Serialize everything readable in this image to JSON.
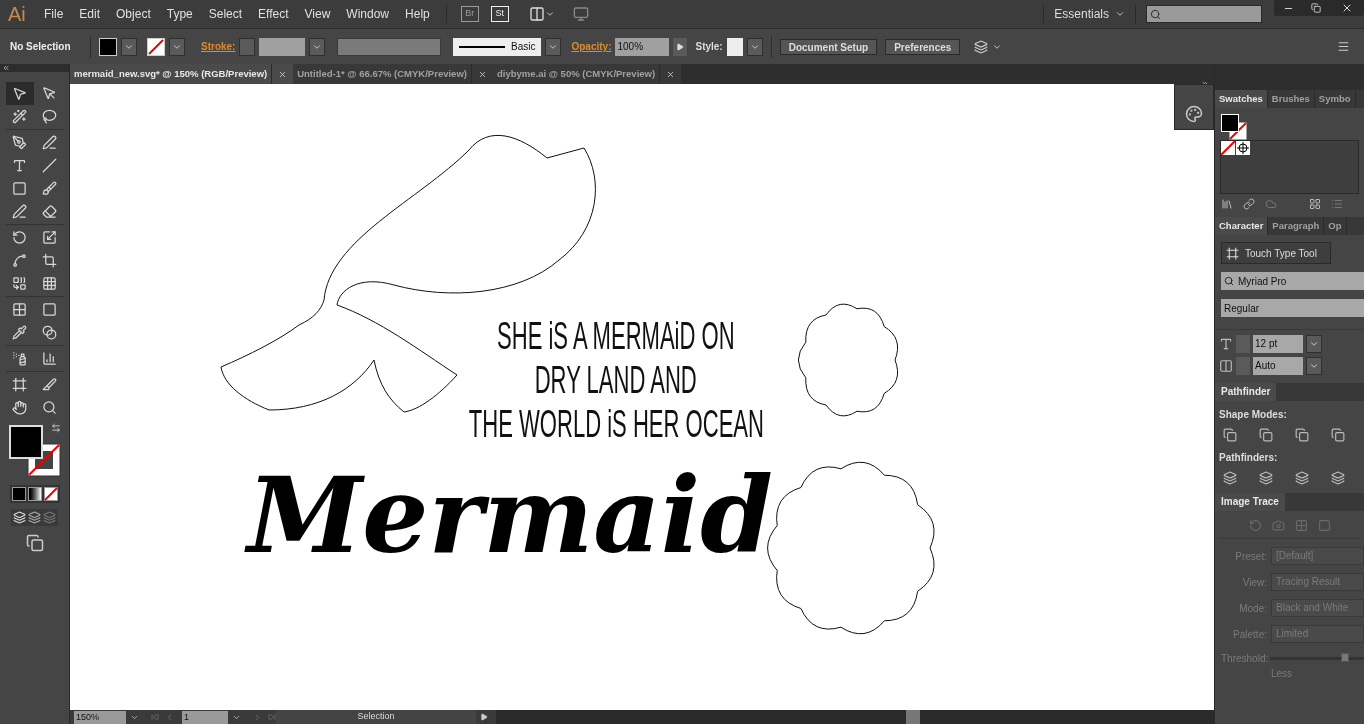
{
  "app_logo": "Ai",
  "menu": [
    "File",
    "Edit",
    "Object",
    "Type",
    "Select",
    "Effect",
    "View",
    "Window",
    "Help"
  ],
  "app_buttons": [
    {
      "label": "Br",
      "disabled": true
    },
    {
      "label": "St",
      "disabled": false
    }
  ],
  "workspace": "Essentials",
  "control_bar": {
    "selection": "No Selection",
    "stroke_label": "Stroke:",
    "brush": "Basic",
    "opacity_label": "Opacity:",
    "opacity": "100%",
    "style_label": "Style:",
    "buttons": [
      "Document Setup",
      "Preferences"
    ]
  },
  "tabs": [
    {
      "label": "mermaid_new.svg* @ 150% (RGB/Preview)",
      "selected": true
    },
    {
      "label": "Untitled-1* @ 66.67% (CMYK/Preview)",
      "selected": false
    },
    {
      "label": "diybyme.ai @ 50% (CMYK/Preview)",
      "selected": false
    }
  ],
  "tools": [
    {
      "kind": "selection",
      "selected": true
    },
    {
      "kind": "direct",
      "selected": false
    },
    {
      "kind": "wand",
      "selected": false
    },
    {
      "kind": "lasso",
      "selected": false
    },
    {
      "kind": "pen",
      "selected": false
    },
    {
      "kind": "curvature",
      "selected": false
    },
    {
      "kind": "type",
      "selected": false
    },
    {
      "kind": "line",
      "selected": false
    },
    {
      "kind": "rectangle",
      "selected": false
    },
    {
      "kind": "brush",
      "selected": false
    },
    {
      "kind": "blob",
      "selected": false
    },
    {
      "kind": "eraser",
      "selected": false
    },
    {
      "kind": "rotate",
      "selected": false
    },
    {
      "kind": "scale",
      "selected": false
    },
    {
      "kind": "warp",
      "selected": false
    },
    {
      "kind": "transform",
      "selected": false
    },
    {
      "kind": "builder",
      "selected": false
    },
    {
      "kind": "perspective",
      "selected": false
    },
    {
      "kind": "mesh",
      "selected": false
    },
    {
      "kind": "gradient",
      "selected": false
    },
    {
      "kind": "eyedropper",
      "selected": false
    },
    {
      "kind": "blend",
      "selected": false
    },
    {
      "kind": "sprayer",
      "selected": false
    },
    {
      "kind": "graph",
      "selected": false
    },
    {
      "kind": "artboard",
      "selected": false
    },
    {
      "kind": "slice",
      "selected": false
    },
    {
      "kind": "hand",
      "selected": false
    },
    {
      "kind": "zoom",
      "selected": false
    }
  ],
  "canvas": {
    "quote_lines": [
      "SHE iS A MERMAiD ON",
      "DRY LAND AND",
      "THE WORLD iS HER OCEAN"
    ],
    "title": "Mermaid"
  },
  "swatches_panel": {
    "tabs": [
      {
        "label": "Swatches",
        "selected": true
      },
      {
        "label": "Brushes",
        "selected": false
      },
      {
        "label": "Symbo",
        "selected": false
      }
    ]
  },
  "character_panel": {
    "tabs": [
      {
        "label": "Character",
        "selected": true
      },
      {
        "label": "Paragraph",
        "selected": false
      },
      {
        "label": "Op",
        "selected": false
      }
    ],
    "touch_type_button": "Touch Type Tool",
    "font_family": "Myriad Pro",
    "font_style": "Regular",
    "font_size": "12 pt",
    "tracking": "Auto"
  },
  "pathfinder_panel": {
    "title": "Pathfinder",
    "shape_modes_label": "Shape Modes:",
    "pathfinders_label": "Pathfinders:"
  },
  "image_trace_panel": {
    "title": "Image Trace",
    "fields": [
      {
        "label": "Preset:",
        "value": "[Default]"
      },
      {
        "label": "View:",
        "value": "Tracing Result"
      },
      {
        "label": "Mode:",
        "value": "Black and White"
      },
      {
        "label": "Palette:",
        "value": "Limited"
      }
    ],
    "threshold_label": "Threshold:",
    "threshold": {
      "level": 0.8
    },
    "less_label": "Less"
  },
  "status_bar": {
    "zoom": "150%",
    "artboard": "1",
    "tool": "Selection"
  }
}
